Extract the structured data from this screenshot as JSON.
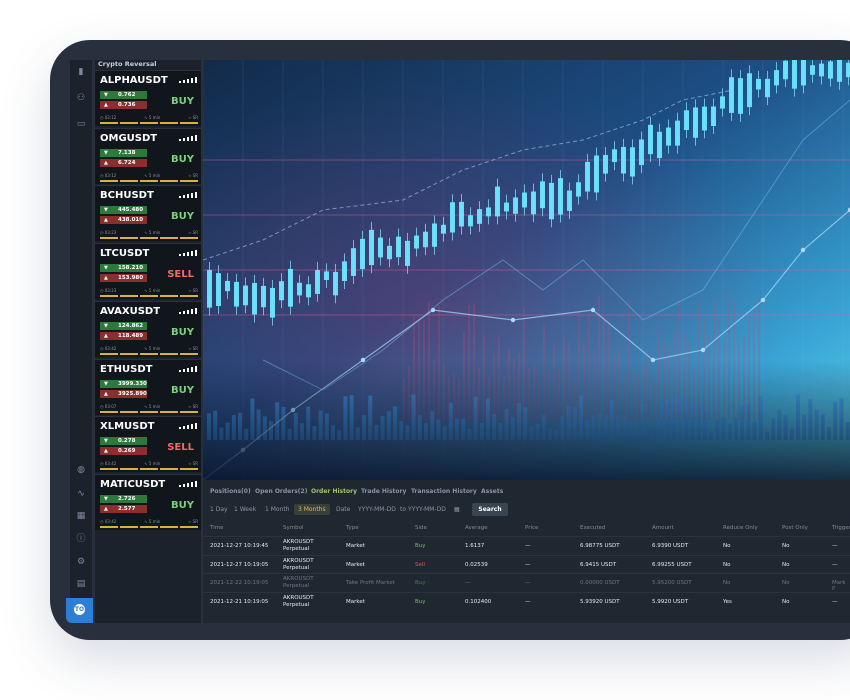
{
  "sidebar": {
    "icons": [
      "signal-icon",
      "network-icon",
      "card-icon",
      "globe-icon",
      "chart-line-icon",
      "calendar-icon",
      "info-icon",
      "settings-icon",
      "book-icon"
    ],
    "badge": "TO"
  },
  "list": {
    "title": "Crypto Reversal",
    "cards": [
      {
        "symbol": "ALPHAUSDT",
        "up": "0.762",
        "down": "0.736",
        "action": "BUY",
        "kind": "buy",
        "time": "02:12",
        "tf": "5 min",
        "sr": "SR"
      },
      {
        "symbol": "OMGUSDT",
        "up": "7.138",
        "down": "6.724",
        "action": "BUY",
        "kind": "buy",
        "time": "03:12",
        "tf": "5 min",
        "sr": "SR"
      },
      {
        "symbol": "BCHUSDT",
        "up": "445.480",
        "down": "438.010",
        "action": "BUY",
        "kind": "buy",
        "time": "03:23",
        "tf": "5 min",
        "sr": "SR"
      },
      {
        "symbol": "LTCUSDT",
        "up": "158.210",
        "down": "153.980",
        "action": "SELL",
        "kind": "sell",
        "time": "03:23",
        "tf": "5 min",
        "sr": "SR"
      },
      {
        "symbol": "AVAXUSDT",
        "up": "124.862",
        "down": "118.489",
        "action": "BUY",
        "kind": "buy",
        "time": "03:42",
        "tf": "5 min",
        "sr": "SR"
      },
      {
        "symbol": "ETHUSDT",
        "up": "3999.330",
        "down": "3925.890",
        "action": "BUY",
        "kind": "buy",
        "time": "03:07",
        "tf": "5 min",
        "sr": "SR"
      },
      {
        "symbol": "XLMUSDT",
        "up": "0.278",
        "down": "0.269",
        "action": "SELL",
        "kind": "sell",
        "time": "03:42",
        "tf": "5 min",
        "sr": "SR"
      },
      {
        "symbol": "MATICUSDT",
        "up": "2.726",
        "down": "2.577",
        "action": "BUY",
        "kind": "buy",
        "time": "03:42",
        "tf": "5 min",
        "sr": "SR"
      }
    ]
  },
  "panel": {
    "tabs": [
      "Positions(0)",
      "Open Orders(2)",
      "Order History",
      "Trade History",
      "Transaction History",
      "Assets"
    ],
    "active_tab": "Order History",
    "filters": [
      "1 Day",
      "1 Week",
      "1 Month",
      "3 Months"
    ],
    "active_filter": "3 Months",
    "date_label": "Date",
    "date_from_placeholder": "YYYY-MM-DD",
    "date_to_label": "to",
    "date_to_placeholder": "YYYY-MM-DD",
    "search_label": "Search",
    "columns": [
      "Time",
      "Symbol",
      "Type",
      "Side",
      "Average",
      "Price",
      "Executed",
      "Amount",
      "Reduce Only",
      "Post Only",
      "Trigger"
    ],
    "rows": [
      {
        "time": "2021-12-27 10:19:45",
        "symbol": "AKROUSDT",
        "sub": "Perpetual",
        "type": "Market",
        "side": "Buy",
        "average": "1.6137",
        "price": "—",
        "executed": "6.98775 USDT",
        "amount": "6.9390 USDT",
        "reduce": "No",
        "post": "No",
        "trigger": "—",
        "dim": false
      },
      {
        "time": "2021-12-27 10:19:05",
        "symbol": "AKROUSDT",
        "sub": "Perpetual",
        "type": "Market",
        "side": "Sell",
        "average": "0.02539",
        "price": "—",
        "executed": "6.9415 USDT",
        "amount": "6.99255 USDT",
        "reduce": "No",
        "post": "No",
        "trigger": "—",
        "dim": false
      },
      {
        "time": "2021-12-22 10:19:05",
        "symbol": "AKROUSDT",
        "sub": "Perpetual",
        "type": "Take Profit Market",
        "side": "Buy",
        "average": "—",
        "price": "—",
        "executed": "0.00000 USDT",
        "amount": "5.95200 USDT",
        "reduce": "No",
        "post": "No",
        "trigger": "Mark P",
        "dim": true
      },
      {
        "time": "2021-12-21 10:19:05",
        "symbol": "AKROUSDT",
        "sub": "Perpetual",
        "type": "Market",
        "side": "Buy",
        "average": "0.102400",
        "price": "—",
        "executed": "5.93920 USDT",
        "amount": "5.9920 USDT",
        "reduce": "Yes",
        "post": "No",
        "trigger": "—",
        "dim": false
      }
    ]
  }
}
